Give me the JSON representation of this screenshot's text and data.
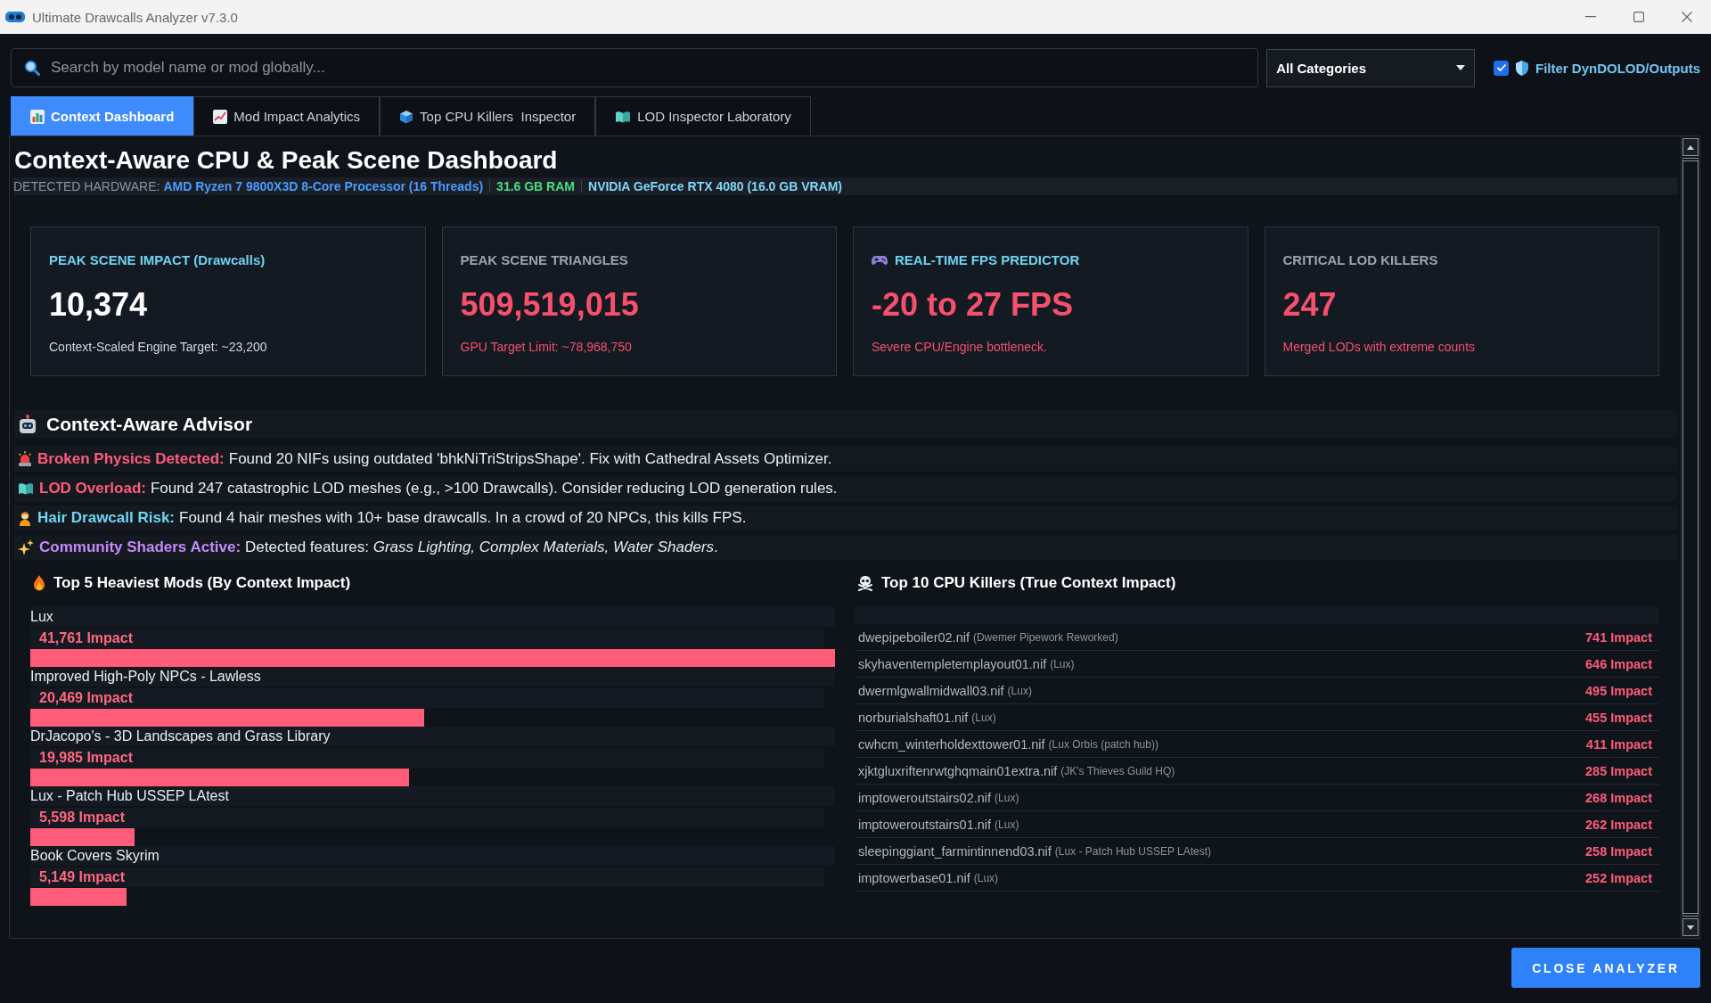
{
  "window": {
    "title": "Ultimate Drawcalls Analyzer v7.3.0"
  },
  "toolbar": {
    "search": {
      "placeholder": "Search by model name or mod globally..."
    },
    "category_dropdown": {
      "value": "All Categories"
    },
    "filter": {
      "label": "Filter DynDOLOD/Outputs",
      "checked": true
    }
  },
  "tabs": [
    {
      "label": "Context Dashboard",
      "selected": true
    },
    {
      "label": "Mod Impact Analytics",
      "selected": false
    },
    {
      "label": "Top CPU Killers  Inspector",
      "selected": false
    },
    {
      "label": "LOD Inspector Laboratory",
      "selected": false
    }
  ],
  "dashboard": {
    "title": "Context-Aware CPU & Peak Scene Dashboard",
    "hardware": {
      "label": "DETECTED HARDWARE:",
      "cpu": "AMD Ryzen 7 9800X3D 8-Core Processor (16 Threads)",
      "ram": "31.6 GB RAM",
      "gpu": "NVIDIA GeForce RTX 4080 (16.0 GB VRAM)"
    },
    "cards": [
      {
        "kind": "drawcalls",
        "label": "PEAK SCENE IMPACT (Drawcalls)",
        "highlighted": true,
        "value": "10,374",
        "critical": false,
        "note": "Context-Scaled Engine Target: ~23,200"
      },
      {
        "kind": "triangles",
        "label": "PEAK SCENE TRIANGLES",
        "highlighted": false,
        "value": "509,519,015",
        "critical": true,
        "note": "GPU Target Limit: ~78,968,750"
      },
      {
        "kind": "fps",
        "label": "REAL-TIME FPS PREDICTOR",
        "highlighted": true,
        "value": "-20 to 27 FPS",
        "critical": true,
        "note": "Severe CPU/Engine bottleneck."
      },
      {
        "kind": "lod",
        "label": "CRITICAL LOD KILLERS",
        "highlighted": false,
        "value": "247",
        "critical": true,
        "note": "Merged LODs with extreme counts"
      }
    ]
  },
  "advisor": {
    "title": "Context-Aware Advisor",
    "items": [
      {
        "title": "Broken Physics Detected:",
        "message": "Found 20 NIFs using outdated 'bhkNiTriStripsShape'. Fix with Cathedral Assets Optimizer.",
        "color": "#ff5c7a"
      },
      {
        "title": "LOD Overload:",
        "message": "Found 247 catastrophic LOD meshes (e.g., >100 Drawcalls). Consider reducing LOD generation rules.",
        "color": "#ff5c7a"
      },
      {
        "title": "Hair Drawcall Risk:",
        "message": "Found 4 hair meshes with 10+ base drawcalls. In a crowd of 20 NPCs, this kills FPS.",
        "color": "#6fd6f2"
      },
      {
        "title": "Community Shaders Active:",
        "message": "Detected features: *Grass Lighting, Complex Materials, Water Shaders*.",
        "color": "#c58af9"
      }
    ]
  },
  "heaviest_mods": {
    "title": "Top 5 Heaviest Mods (By Context Impact)",
    "mods": [
      {
        "name": "Lux",
        "impact": "41,761 Impact",
        "level": 1
      },
      {
        "name": "Improved High-Poly NPCs - Lawless",
        "impact": "20,469 Impact",
        "level": 0.49
      },
      {
        "name": "DrJacopo's - 3D Landscapes and Grass Library",
        "impact": "19,985 Impact",
        "level": 0.471
      },
      {
        "name": "Lux - Patch Hub USSEP LAtest",
        "impact": "5,598 Impact",
        "level": 0.13
      },
      {
        "name": "Book Covers Skyrim",
        "impact": "5,149 Impact",
        "level": 0.12
      }
    ]
  },
  "cpu_killers": {
    "title": "Top 10 CPU Killers (True Context Impact)",
    "rows": [
      {
        "file": "dwepipeboiler02.nif",
        "mod": "(Dwemer Pipework Reworked)",
        "impact": "741 Impact"
      },
      {
        "file": "skyhaventempletemplayout01.nif",
        "mod": "(Lux)",
        "impact": "646 Impact"
      },
      {
        "file": "dwermlgwallmidwall03.nif",
        "mod": "(Lux)",
        "impact": "495 Impact"
      },
      {
        "file": "norburialshaft01.nif",
        "mod": "(Lux)",
        "impact": "455 Impact"
      },
      {
        "file": "cwhcm_winterholdexttower01.nif",
        "mod": "(Lux Orbis (patch hub))",
        "impact": "411 Impact"
      },
      {
        "file": "xjktgluxriftenrwtghqmain01extra.nif",
        "mod": "(JK's Thieves Guild HQ)",
        "impact": "285 Impact"
      },
      {
        "file": "imptoweroutstairs02.nif",
        "mod": "(Lux)",
        "impact": "268 Impact"
      },
      {
        "file": "imptoweroutstairs01.nif",
        "mod": "(Lux)",
        "impact": "262 Impact"
      },
      {
        "file": "sleepinggiant_farmintinnend03.nif",
        "mod": "(Lux - Patch Hub USSEP LAtest)",
        "impact": "258 Impact"
      },
      {
        "file": "imptowerbase01.nif",
        "mod": "(Lux)",
        "impact": "252 Impact"
      }
    ]
  },
  "close_button": {
    "label": "CLOSE ANALYZER"
  }
}
